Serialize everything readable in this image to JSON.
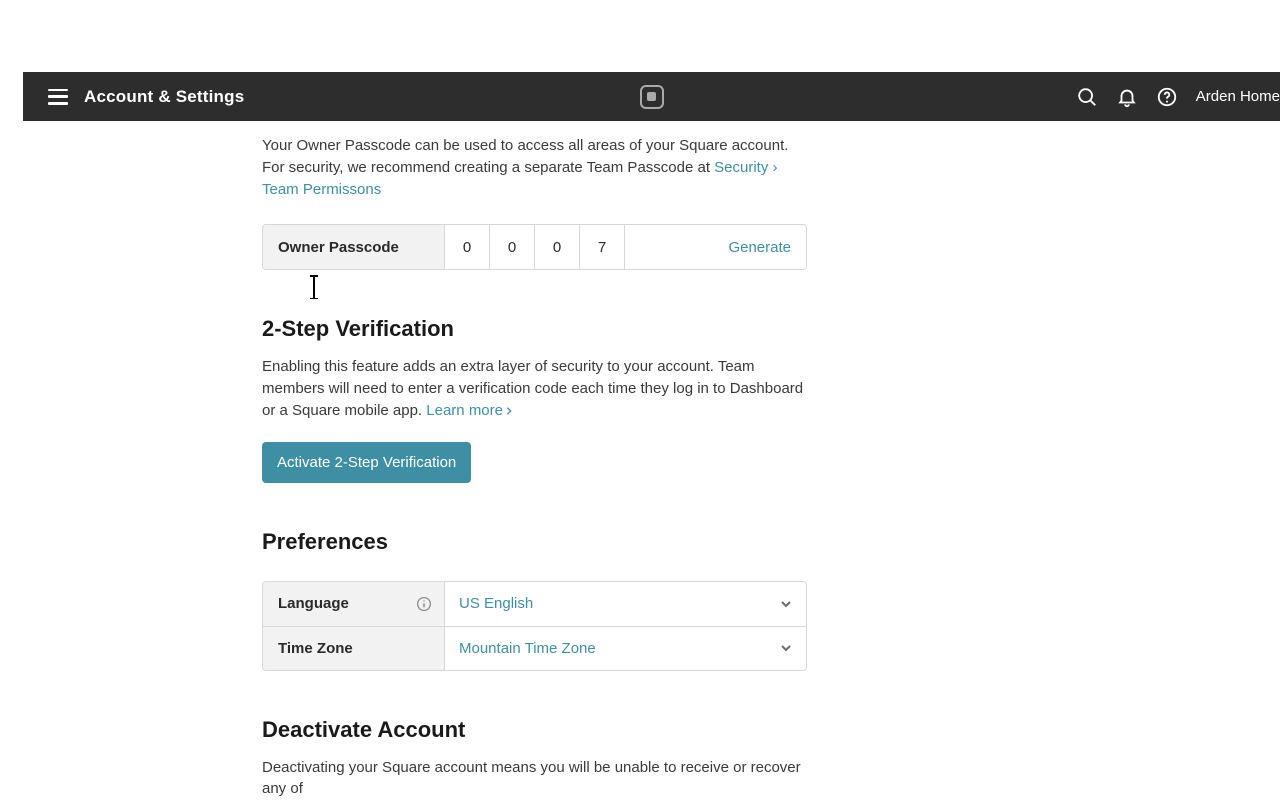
{
  "topbar": {
    "title": "Account & Settings",
    "user": "Arden Home"
  },
  "passcode": {
    "description_a": "Your Owner Passcode can be used to access all areas of your Square account. For security, we recommend creating a separate Team Passcode at ",
    "link": "Security › Team Permissons",
    "label": "Owner Passcode",
    "digits": [
      "0",
      "0",
      "0",
      "7"
    ],
    "generate": "Generate"
  },
  "twostep": {
    "heading": "2-Step Verification",
    "desc": "Enabling this feature adds an extra layer of security to your account. Team members will need to enter a verification code each time they log in to Dashboard or a Square mobile app.",
    "learn": "Learn more",
    "button": "Activate 2-Step Verification"
  },
  "prefs": {
    "heading": "Preferences",
    "language_label": "Language",
    "language_value": "US English",
    "timezone_label": "Time Zone",
    "timezone_value": "Mountain Time Zone"
  },
  "deactivate": {
    "heading": "Deactivate Account",
    "desc": "Deactivating your Square account means you will be unable to receive or recover any of"
  }
}
